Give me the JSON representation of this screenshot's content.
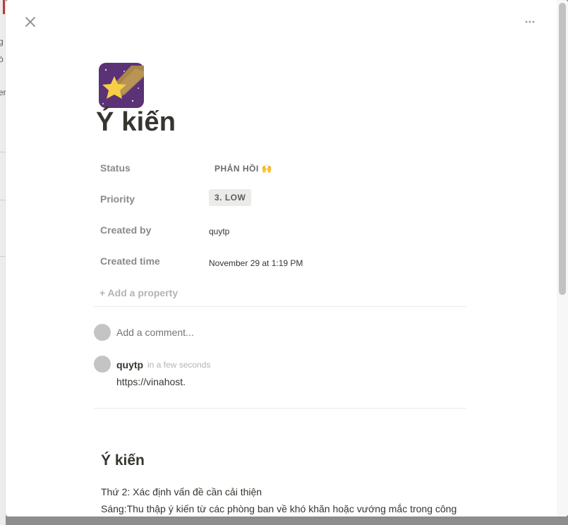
{
  "background": {
    "fragments": [
      "g",
      "ó",
      "er"
    ]
  },
  "toolbar": {
    "close_icon": "close-icon",
    "more_icon": "more-horizontal-icon"
  },
  "page": {
    "icon": "shooting-star-icon",
    "title": "Ý kiến"
  },
  "properties": {
    "status": {
      "label": "Status",
      "value": "PHẢN HỒI 🙌"
    },
    "priority": {
      "label": "Priority",
      "value": "3. LOW"
    },
    "created_by": {
      "label": "Created by",
      "value": "quytp"
    },
    "created_time": {
      "label": "Created time",
      "value": "November 29 at 1:19 PM"
    },
    "add_label": "+ Add a property"
  },
  "comments": {
    "placeholder": "Add a comment...",
    "items": [
      {
        "author": "quytp",
        "time": "in a few seconds",
        "text": "https://vinahost."
      }
    ]
  },
  "content": {
    "heading": "Ý kiến",
    "lines": [
      "Thứ 2: Xác định vấn đề cần cải thiện",
      "Sáng:Thu thập ý kiến từ các phòng ban về khó khăn hoặc vướng mắc trong công"
    ]
  },
  "colors": {
    "icon_bg": "#5b3275",
    "star": "#f7ce46",
    "trail": "#a8864a",
    "priority_bg": "#ebebea"
  }
}
